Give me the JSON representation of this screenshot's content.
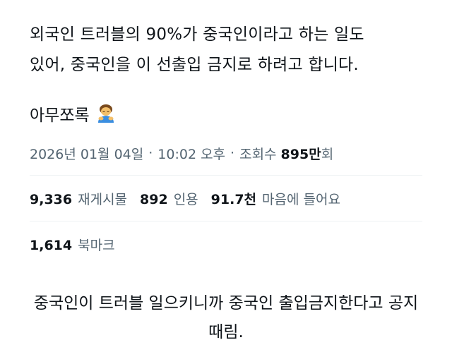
{
  "tweet": {
    "lines": [
      "외국인 트러블의 90%가 중국인이라고 하는 일도",
      "있어, 중국인을 이 선출입 금지로 하려고 합니다."
    ],
    "reaction_text": "아무쪼록",
    "reaction_emoji": "person-bowing-emoji"
  },
  "meta": {
    "date": "2026년 01월 04일",
    "sep1": "·",
    "time": "10:02 오후",
    "sep2": "·",
    "views_prefix": "조회수",
    "views_value": "895만",
    "views_suffix": "회"
  },
  "stats": {
    "reposts_count": "9,336",
    "reposts_label": "재게시물",
    "quotes_count": "892",
    "quotes_label": "인용",
    "likes_count": "91.7천",
    "likes_label": "마음에 들어요",
    "bookmarks_count": "1,614",
    "bookmarks_label": "북마크"
  },
  "caption": {
    "lines": [
      "중국인이 트러블 일으키니까 중국인 출입금지한다고 공지",
      "때림."
    ]
  },
  "colors": {
    "text": "#0f1419",
    "muted": "#536471",
    "divider": "#eff3f4"
  }
}
